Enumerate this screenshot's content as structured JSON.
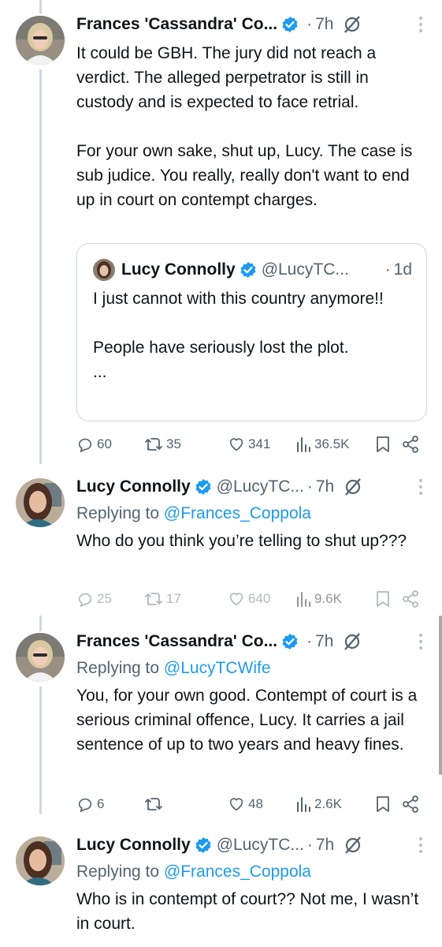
{
  "colors": {
    "accent": "#1d9bf0",
    "text": "#0f1419",
    "muted": "#536471",
    "border": "#cfd9de"
  },
  "tweets": [
    {
      "name": "Frances 'Cassandra' Co...",
      "handle": "",
      "time": "7h",
      "reply_to_prefix": "",
      "reply_to": "",
      "text": "It could be GBH. The jury did not reach a verdict. The alleged perpetrator is still in custody and is expected to face retrial.\n\nFor your own sake, shut up, Lucy. The case is sub judice. You really, really don't want to end up in court on contempt charges.",
      "quote": {
        "name": "Lucy Connolly",
        "handle": "@LucyTC...",
        "time": "1d",
        "text": "I just cannot with this country anymore!!\n\nPeople have seriously lost the plot.\n..."
      },
      "stats": {
        "replies": "60",
        "retweets": "35",
        "likes": "341",
        "views": "36.5K"
      }
    },
    {
      "name": "Lucy Connolly",
      "handle": "@LucyTC...",
      "time": "7h",
      "reply_to_prefix": "Replying to",
      "reply_to": "@Frances_Coppola",
      "text": "Who do you think you’re telling to shut up???",
      "stats": {
        "replies": "25",
        "retweets": "17",
        "likes": "640",
        "views": "9.6K"
      }
    },
    {
      "name": "Frances 'Cassandra' Co...",
      "handle": "",
      "time": "7h",
      "reply_to_prefix": "Replying to",
      "reply_to": "@LucyTCWife",
      "text": "You, for your own good. Contempt of court is a serious criminal offence, Lucy. It carries a jail sentence of up to two years and heavy fines.",
      "stats": {
        "replies": "6",
        "retweets": "",
        "likes": "48",
        "views": "2.6K"
      }
    },
    {
      "name": "Lucy Connolly",
      "handle": "@LucyTC...",
      "time": "7h",
      "reply_to_prefix": "Replying to",
      "reply_to": "@Frances_Coppola",
      "text": "Who is in contempt of court?? Not me, I wasn’t in court."
    }
  ]
}
